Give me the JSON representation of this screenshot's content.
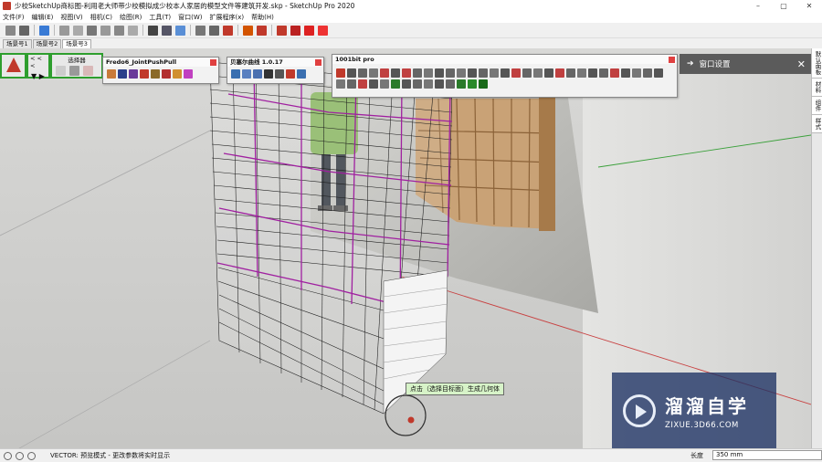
{
  "window": {
    "title": "少校SketchUp商标图-利用老大师带少校模拟成少校本人家居的模型文件等建筑开发.skp - SketchUp Pro 2020",
    "controls": [
      "–",
      "▢",
      "✕"
    ]
  },
  "menu": [
    "文件(F)",
    "编辑(E)",
    "视图(V)",
    "相机(C)",
    "绘图(R)",
    "工具(T)",
    "窗口(W)",
    "扩展程序(x)",
    "帮助(H)"
  ],
  "scene_tabs": [
    "场景号1",
    "场景号2",
    "场景号3"
  ],
  "panel": {
    "title": "默认面板",
    "header": "窗口设置",
    "close": "✕"
  },
  "right_tabs": [
    "默认面板",
    "材料",
    "组件",
    "样式"
  ],
  "toolbars": {
    "left_label": "< < <",
    "playback": "▼ ▶",
    "small_title": "选择器",
    "fredo": {
      "title": "Fredo6_JointPushPull"
    },
    "bezier": {
      "title": "贝塞尔曲线 1.0.17"
    },
    "bit1001": {
      "title": "1001bit pro"
    }
  },
  "viewport": {
    "tooltip": "点击（选择目标面）生成几何体"
  },
  "status": {
    "text": "VECTOR: 预览模式 - 更改参数将实时显示",
    "measure_label": "长度",
    "measure_value": "350 mm"
  },
  "watermark": {
    "title": "溜溜自学",
    "subtitle": "ZIXUE.3D66.COM"
  },
  "colors": {
    "green_border": "#2e9e2e",
    "magenta_edges": "#a020a0",
    "panel_header": "#5b5b5b",
    "tooltip_bg": "#d7f3c8",
    "watermark_bg": "#1e3264"
  }
}
